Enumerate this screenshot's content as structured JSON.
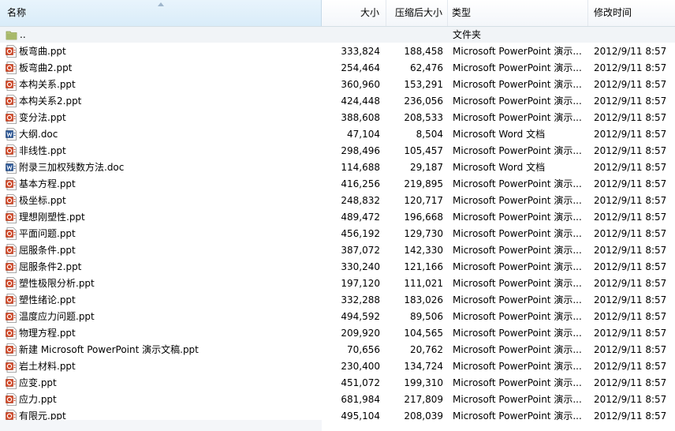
{
  "columns": {
    "name": "名称",
    "size": "大小",
    "compressed": "压缩后大小",
    "type": "类型",
    "modified": "修改时间"
  },
  "parent_row": {
    "name": "..",
    "type": "文件夹",
    "icon": "folder-icon"
  },
  "files": [
    {
      "name": "板弯曲.ppt",
      "size": "333,824",
      "compressed": "188,458",
      "type": "Microsoft PowerPoint 演示...",
      "modified": "2012/9/11 8:57",
      "icon": "powerpoint-file-icon"
    },
    {
      "name": "板弯曲2.ppt",
      "size": "254,464",
      "compressed": "62,476",
      "type": "Microsoft PowerPoint 演示...",
      "modified": "2012/9/11 8:57",
      "icon": "powerpoint-file-icon"
    },
    {
      "name": "本构关系.ppt",
      "size": "360,960",
      "compressed": "153,291",
      "type": "Microsoft PowerPoint 演示...",
      "modified": "2012/9/11 8:57",
      "icon": "powerpoint-file-icon"
    },
    {
      "name": "本构关系2.ppt",
      "size": "424,448",
      "compressed": "236,056",
      "type": "Microsoft PowerPoint 演示...",
      "modified": "2012/9/11 8:57",
      "icon": "powerpoint-file-icon"
    },
    {
      "name": "变分法.ppt",
      "size": "388,608",
      "compressed": "208,533",
      "type": "Microsoft PowerPoint 演示...",
      "modified": "2012/9/11 8:57",
      "icon": "powerpoint-file-icon"
    },
    {
      "name": "大纲.doc",
      "size": "47,104",
      "compressed": "8,504",
      "type": "Microsoft Word 文档",
      "modified": "2012/9/11 8:57",
      "icon": "word-file-icon"
    },
    {
      "name": "非线性.ppt",
      "size": "298,496",
      "compressed": "105,457",
      "type": "Microsoft PowerPoint 演示...",
      "modified": "2012/9/11 8:57",
      "icon": "powerpoint-file-icon"
    },
    {
      "name": "附录三加权残数方法.doc",
      "size": "114,688",
      "compressed": "29,187",
      "type": "Microsoft Word 文档",
      "modified": "2012/9/11 8:57",
      "icon": "word-file-icon"
    },
    {
      "name": "基本方程.ppt",
      "size": "416,256",
      "compressed": "219,895",
      "type": "Microsoft PowerPoint 演示...",
      "modified": "2012/9/11 8:57",
      "icon": "powerpoint-file-icon"
    },
    {
      "name": "极坐标.ppt",
      "size": "248,832",
      "compressed": "120,717",
      "type": "Microsoft PowerPoint 演示...",
      "modified": "2012/9/11 8:57",
      "icon": "powerpoint-file-icon"
    },
    {
      "name": "理想刚塑性.ppt",
      "size": "489,472",
      "compressed": "196,668",
      "type": "Microsoft PowerPoint 演示...",
      "modified": "2012/9/11 8:57",
      "icon": "powerpoint-file-icon"
    },
    {
      "name": "平面问题.ppt",
      "size": "456,192",
      "compressed": "129,730",
      "type": "Microsoft PowerPoint 演示...",
      "modified": "2012/9/11 8:57",
      "icon": "powerpoint-file-icon"
    },
    {
      "name": "屈服条件.ppt",
      "size": "387,072",
      "compressed": "142,330",
      "type": "Microsoft PowerPoint 演示...",
      "modified": "2012/9/11 8:57",
      "icon": "powerpoint-file-icon"
    },
    {
      "name": "屈服条件2.ppt",
      "size": "330,240",
      "compressed": "121,166",
      "type": "Microsoft PowerPoint 演示...",
      "modified": "2012/9/11 8:57",
      "icon": "powerpoint-file-icon"
    },
    {
      "name": "塑性极限分析.ppt",
      "size": "197,120",
      "compressed": "111,021",
      "type": "Microsoft PowerPoint 演示...",
      "modified": "2012/9/11 8:57",
      "icon": "powerpoint-file-icon"
    },
    {
      "name": "塑性绪论.ppt",
      "size": "332,288",
      "compressed": "183,026",
      "type": "Microsoft PowerPoint 演示...",
      "modified": "2012/9/11 8:57",
      "icon": "powerpoint-file-icon"
    },
    {
      "name": "温度应力问题.ppt",
      "size": "494,592",
      "compressed": "89,506",
      "type": "Microsoft PowerPoint 演示...",
      "modified": "2012/9/11 8:57",
      "icon": "powerpoint-file-icon"
    },
    {
      "name": "物理方程.ppt",
      "size": "209,920",
      "compressed": "104,565",
      "type": "Microsoft PowerPoint 演示...",
      "modified": "2012/9/11 8:57",
      "icon": "powerpoint-file-icon"
    },
    {
      "name": "新建 Microsoft PowerPoint 演示文稿.ppt",
      "size": "70,656",
      "compressed": "20,762",
      "type": "Microsoft PowerPoint 演示...",
      "modified": "2012/9/11 8:57",
      "icon": "powerpoint-file-icon"
    },
    {
      "name": "岩土材料.ppt",
      "size": "230,400",
      "compressed": "134,724",
      "type": "Microsoft PowerPoint 演示...",
      "modified": "2012/9/11 8:57",
      "icon": "powerpoint-file-icon"
    },
    {
      "name": "应变.ppt",
      "size": "451,072",
      "compressed": "199,310",
      "type": "Microsoft PowerPoint 演示...",
      "modified": "2012/9/11 8:57",
      "icon": "powerpoint-file-icon"
    },
    {
      "name": "应力.ppt",
      "size": "681,984",
      "compressed": "217,809",
      "type": "Microsoft PowerPoint 演示...",
      "modified": "2012/9/11 8:57",
      "icon": "powerpoint-file-icon"
    },
    {
      "name": "有限元.ppt",
      "size": "495,104",
      "compressed": "208,039",
      "type": "Microsoft PowerPoint 演示...",
      "modified": "2012/9/11 8:57",
      "icon": "powerpoint-file-icon"
    }
  ],
  "colors": {
    "header_active": "#d9ecf9",
    "parent_row_bg": "#f1f4f7",
    "ppt_icon": "#c8502b",
    "word_icon": "#2b5797",
    "folder_icon": "#a7b86a"
  }
}
